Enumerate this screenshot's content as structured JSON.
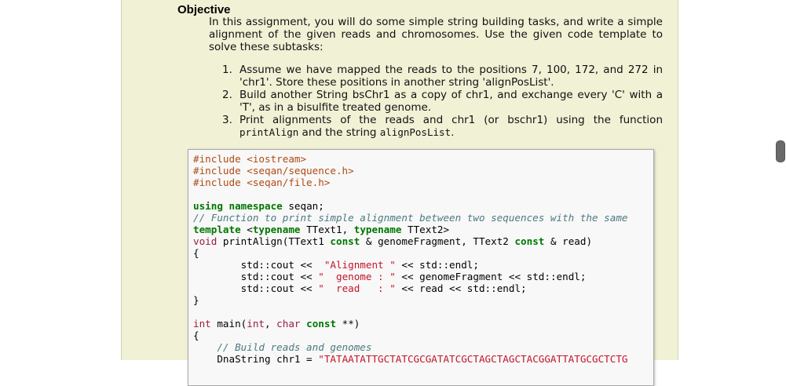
{
  "heading": "Objective",
  "intro": "In this assignment, you will do some simple string building tasks, and write a simple alignment of the given reads and chromosomes. Use the given code template to solve these subtasks:",
  "tasks": [
    {
      "num": "1.",
      "text": "Assume we have mapped the reads to the positions 7, 100, 172, and 272 in 'chr1'. Store these positions in another string 'alignPosList'."
    },
    {
      "num": "2.",
      "text": "Build another String bsChr1 as a copy of chr1, and exchange every 'C' with a 'T', as in a bisulfite treated genome."
    },
    {
      "num": "3.",
      "pre": "Print alignments of the reads and chr1 (or bschr1) using the function ",
      "code1": "printAlign",
      "mid": " and the string ",
      "code2": "alignPosList",
      "post": "."
    }
  ],
  "code": {
    "l1": "#include <iostream>",
    "l2": "#include <seqan/sequence.h>",
    "l3": "#include <seqan/file.h>",
    "l5a": "using namespace",
    "l5b": " seqan;",
    "l6": "// Function to print simple alignment between two sequences with the same",
    "l7a": "template",
    "l7b": " <",
    "l7c": "typename",
    "l7d": " TText1, ",
    "l7e": "typename",
    "l7f": " TText2>",
    "l8a": "void",
    "l8b": " printAlign(TText1 ",
    "l8c": "const",
    "l8d": " & genomeFragment, TText2 ",
    "l8e": "const",
    "l8f": " & read)",
    "l9": "{",
    "l10a": "        std::cout <<  ",
    "l10b": "\"Alignment \"",
    "l10c": " << std::endl;",
    "l11a": "        std::cout << ",
    "l11b": "\"  genome : \"",
    "l11c": " << genomeFragment << std::endl;",
    "l12a": "        std::cout << ",
    "l12b": "\"  read   : \"",
    "l12c": " << read << std::endl;",
    "l13": "}",
    "l15a": "int",
    "l15b": " main(",
    "l15c": "int",
    "l15d": ", ",
    "l15e": "char",
    "l15f": " ",
    "l15g": "const",
    "l15h": " **)",
    "l16": "{",
    "l17": "    // Build reads and genomes",
    "l18a": "    DnaString chr1 = ",
    "l18b": "\"TATAATATTGCTATCGCGATATCGCTAGCTAGCTACGGATTATGCGCTCTG"
  }
}
